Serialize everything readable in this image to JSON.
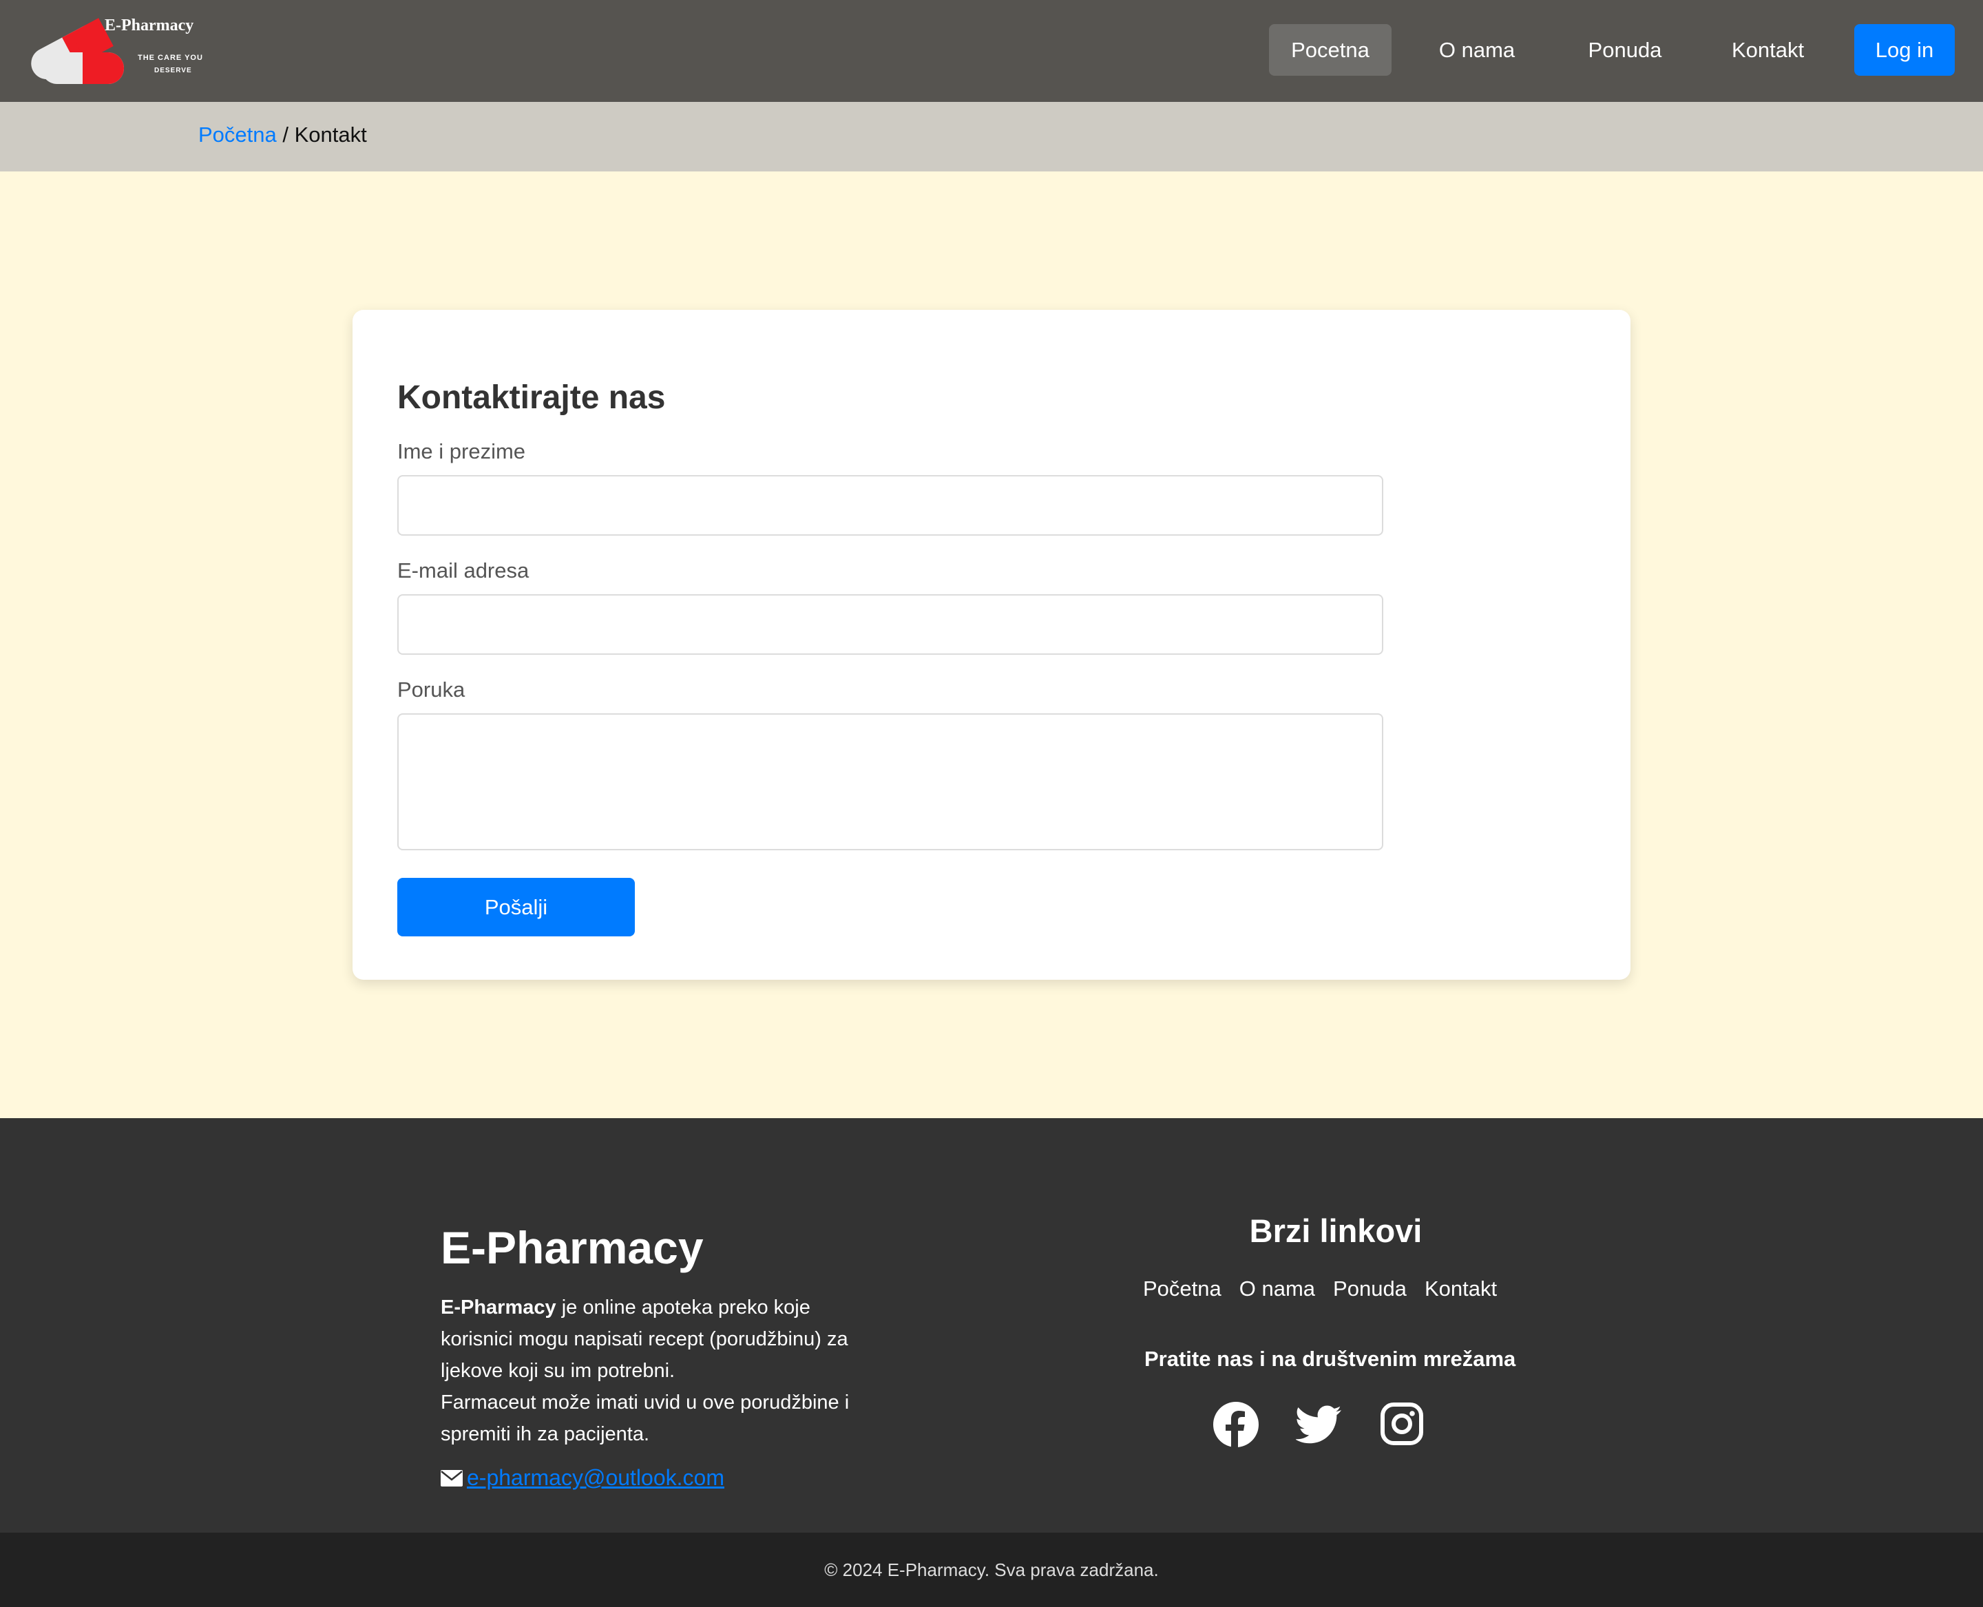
{
  "logo": {
    "name": "E-Pharmacy",
    "tagline_1": "THE CARE YOU",
    "tagline_2": "DESERVE"
  },
  "nav": {
    "items": [
      {
        "label": "Pocetna"
      },
      {
        "label": "O nama"
      },
      {
        "label": "Ponuda"
      },
      {
        "label": "Kontakt"
      }
    ],
    "login_label": "Log in",
    "active": "Pocetna"
  },
  "breadcrumb": {
    "home": "Početna",
    "separator": " / ",
    "current": "Kontakt"
  },
  "form": {
    "title": "Kontaktirajte nas",
    "name_label": "Ime i prezime",
    "name_value": "",
    "email_label": "E-mail adresa",
    "email_value": "",
    "message_label": "Poruka",
    "message_value": "",
    "submit_label": "Pošalji"
  },
  "footer": {
    "brand": "E-Pharmacy",
    "desc_bold": "E-Pharmacy",
    "desc_line1": " je online apoteka preko koje korisnici mogu napisati recept (porudžbinu) za ljekove koji su im potrebni.",
    "desc_line2": "Farmaceut može imati uvid u ove porudžbine i spremiti ih za pacijenta.",
    "email": "e-pharmacy@outlook.com",
    "quick_title": "Brzi linkovi",
    "quick_links": [
      "Početna",
      "O nama",
      "Ponuda",
      "Kontakt"
    ],
    "follow_title": "Pratite nas i na društvenim mrežama",
    "social_icons": [
      "facebook-icon",
      "twitter-icon",
      "instagram-icon"
    ]
  },
  "copyright": "© 2024 E-Pharmacy. Sva prava zadržana.",
  "colors": {
    "navbar": "#565450",
    "accent": "#007bff",
    "page_bg": "#fff8dc",
    "footer": "#333333"
  }
}
